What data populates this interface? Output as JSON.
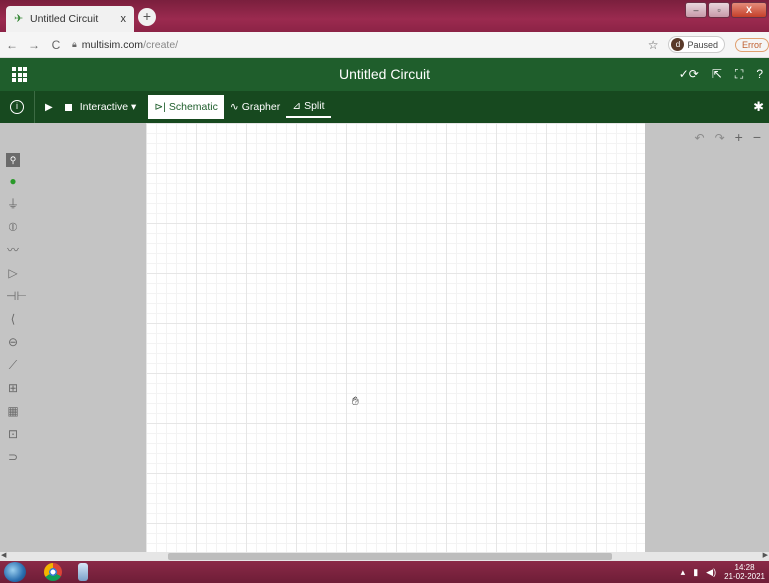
{
  "browser": {
    "tab_title": "Untitled Circuit",
    "tab_close": "x",
    "new_tab": "+",
    "url_host": "multisim.com",
    "url_path": "/create/",
    "profile_initial": "d",
    "profile_status": "Paused",
    "error_label": "Error",
    "window_buttons": {
      "minimize": "–",
      "maximize": "▫",
      "close": "X"
    }
  },
  "app": {
    "title": "Untitled Circuit",
    "toolbar": {
      "mode_label": "Interactive ▾",
      "tabs": [
        {
          "label": "Schematic",
          "icon": "schematic-icon",
          "active": true
        },
        {
          "label": "Grapher",
          "icon": "grapher-icon",
          "active": false
        },
        {
          "label": "Split",
          "icon": "split-icon",
          "active": false
        }
      ]
    },
    "canvas_tools": {
      "undo": "↶",
      "redo": "↷",
      "zoom_in": "+",
      "zoom_out": "−"
    }
  },
  "taskbar": {
    "clock_time": "14:28",
    "clock_date": "21-02-2021"
  }
}
